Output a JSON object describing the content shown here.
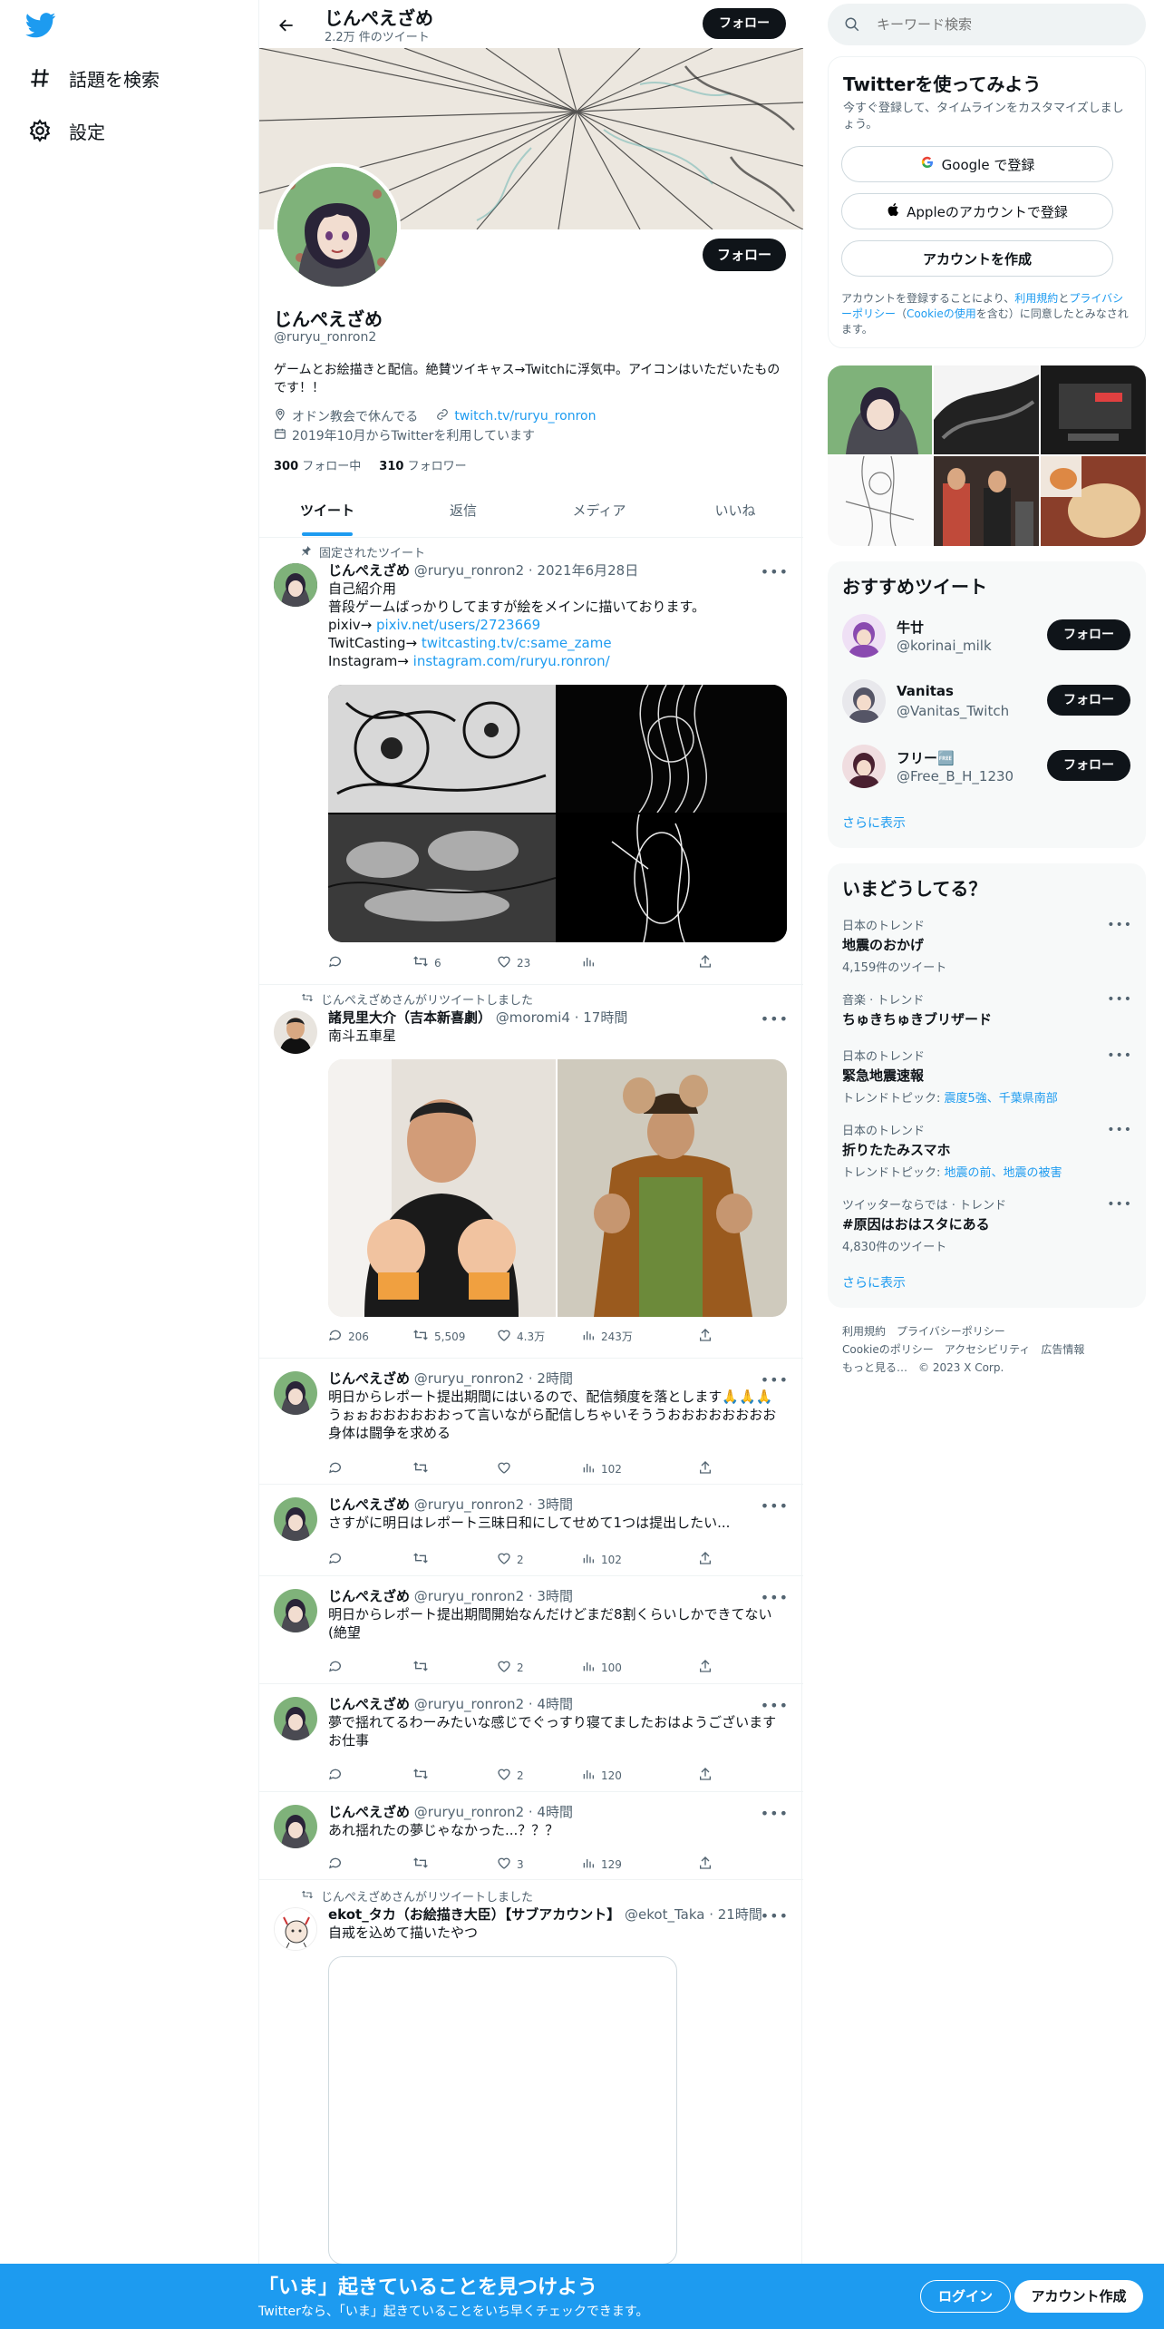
{
  "nav": {
    "explore_label": "話題を検索",
    "settings_label": "設定"
  },
  "header": {
    "name": "じんぺえざめ",
    "tweet_count": "2.2万 件のツイート",
    "follow_label": "フォロー"
  },
  "profile": {
    "name": "じんぺえざめ",
    "handle": "@ruryu_ronron2",
    "bio": "ゲームとお絵描きと配信。絶賛ツイキャス→Twitchに浮気中。アイコンはいただいたものです！！",
    "location": "オドン教会で休んでる",
    "url": "twitch.tv/ruryu_ronron",
    "joined": "2019年10月からTwitterを利用しています",
    "following_count": "300",
    "following_label": "フォロー中",
    "followers_count": "310",
    "followers_label": "フォロワー",
    "follow_label": "フォロー"
  },
  "tabs": [
    "ツイート",
    "返信",
    "メディア",
    "いいね"
  ],
  "tweets": [
    {
      "context": "固定されたツイート",
      "name": "じんぺえざめ",
      "meta": "@ruryu_ronron2 · 2021年6月28日",
      "lines": [
        "自己紹介用",
        "普段ゲームばっかりしてますが絵をメインに描いております。"
      ],
      "links": [
        {
          "prefix": "pixiv→ ",
          "url": "pixiv.net/users/2723669"
        },
        {
          "prefix": "TwitCasting→ ",
          "url": "twitcasting.tv/c:same_zame"
        },
        {
          "prefix": "Instagram→ ",
          "url": "instagram.com/ruryu.ronron/"
        }
      ],
      "reply": "",
      "retweet": "6",
      "like": "23",
      "views": ""
    },
    {
      "context": "じんぺえざめさんがリツイートしました",
      "name": "諸見里大介（吉本新喜劇）",
      "meta": "@moromi4 · 17時間",
      "lines": [
        "南斗五車星"
      ],
      "reply": "206",
      "retweet": "5,509",
      "like": "4.3万",
      "views": "243万"
    },
    {
      "name": "じんぺえざめ",
      "meta": "@ruryu_ronron2 · 2時間",
      "lines": [
        "明日からレポート提出期間にはいるので、配信頻度を落とします🙏🙏🙏",
        "うぉぉおおおおおおって言いながら配信しちゃいそううおおおおおおおお",
        "身体は闘争を求める"
      ],
      "reply": "",
      "retweet": "",
      "like": "",
      "views": "102"
    },
    {
      "name": "じんぺえざめ",
      "meta": "@ruryu_ronron2 · 3時間",
      "lines": [
        "さすがに明日はレポート三昧日和にしてせめて1つは提出したい..."
      ],
      "reply": "",
      "retweet": "",
      "like": "2",
      "views": "102"
    },
    {
      "name": "じんぺえざめ",
      "meta": "@ruryu_ronron2 · 3時間",
      "lines": [
        "明日からレポート提出期間開始なんだけどまだ8割くらいしかできてない",
        "(絶望"
      ],
      "reply": "",
      "retweet": "",
      "like": "2",
      "views": "100"
    },
    {
      "name": "じんぺえざめ",
      "meta": "@ruryu_ronron2 · 4時間",
      "lines": [
        "夢で揺れてるわーみたいな感じでぐっすり寝てましたおはようございます",
        "お仕事"
      ],
      "reply": "",
      "retweet": "",
      "like": "2",
      "views": "120"
    },
    {
      "name": "じんぺえざめ",
      "meta": "@ruryu_ronron2 · 4時間",
      "lines": [
        "あれ揺れたの夢じゃなかった...？？？"
      ],
      "reply": "",
      "retweet": "",
      "like": "3",
      "views": "129"
    },
    {
      "context": "じんぺえざめさんがリツイートしました",
      "name": "ekot_タカ（お絵描き大臣）【サブアカウント】",
      "meta": "@ekot_Taka · 21時間",
      "lines": [
        "自戒を込めて描いたやつ"
      ]
    }
  ],
  "search": {
    "placeholder": "キーワード検索"
  },
  "signup": {
    "title": "Twitterを使ってみよう",
    "subtitle": "今すぐ登録して、タイムラインをカスタマイズしましょう。",
    "google_label": "Google で登録",
    "apple_label": "Appleのアカウントで登録",
    "create_label": "アカウントを作成",
    "terms_prefix": "アカウントを登録することにより、",
    "terms_link": "利用規約",
    "terms_and": "と",
    "privacy_link": "プライバシーポリシー",
    "terms_mid": "（",
    "cookie_link": "Cookieの使用",
    "terms_suffix": "を含む）に同意したとみなされます。"
  },
  "recommended": {
    "title": "おすすめツイート",
    "users": [
      {
        "name": "牛廿",
        "handle": "@korinai_milk"
      },
      {
        "name": "Vanitas",
        "handle": "@Vanitas_Twitch"
      },
      {
        "name": "フリー🆓",
        "handle": "@Free_B_H_1230"
      }
    ],
    "follow_label": "フォロー",
    "show_more": "さらに表示"
  },
  "trends": {
    "title": "いまどうしてる？",
    "items": [
      {
        "category": "日本のトレンド",
        "title": "地震のおかげ",
        "sub": "4,159件のツイート",
        "topic_prefix": "",
        "topic_links": ""
      },
      {
        "category": "音楽 · トレンド",
        "title": "ちゅきちゅきブリザード",
        "sub": "",
        "topic_prefix": "",
        "topic_links": ""
      },
      {
        "category": "日本のトレンド",
        "title": "緊急地震速報",
        "sub": "",
        "topic_prefix": "トレンドトピック: ",
        "topic_links": "震度5強、千葉県南部"
      },
      {
        "category": "日本のトレンド",
        "title": "折りたたみスマホ",
        "sub": "",
        "topic_prefix": "トレンドトピック: ",
        "topic_links": "地震の前、地震の被害"
      },
      {
        "category": "ツイッターならでは · トレンド",
        "title": "#原因はおはスタにある",
        "sub": "4,830件のツイート",
        "topic_prefix": "",
        "topic_links": ""
      }
    ],
    "show_more": "さらに表示"
  },
  "footer": {
    "line1": "利用規約　プライバシーポリシー",
    "line2": "Cookieのポリシー　アクセシビリティ　広告情報",
    "line3": "もっと見る…　© 2023 X Corp."
  },
  "banner": {
    "title": "「いま」起きていることを見つけよう",
    "subtitle": "Twitterなら、「いま」起きていることをいち早くチェックできます。",
    "login_label": "ログイン",
    "signup_label": "アカウント作成"
  },
  "colors": {
    "accent": "#1d9bf0",
    "black_button": "#0f1419",
    "banner": "#1d9bf0"
  }
}
